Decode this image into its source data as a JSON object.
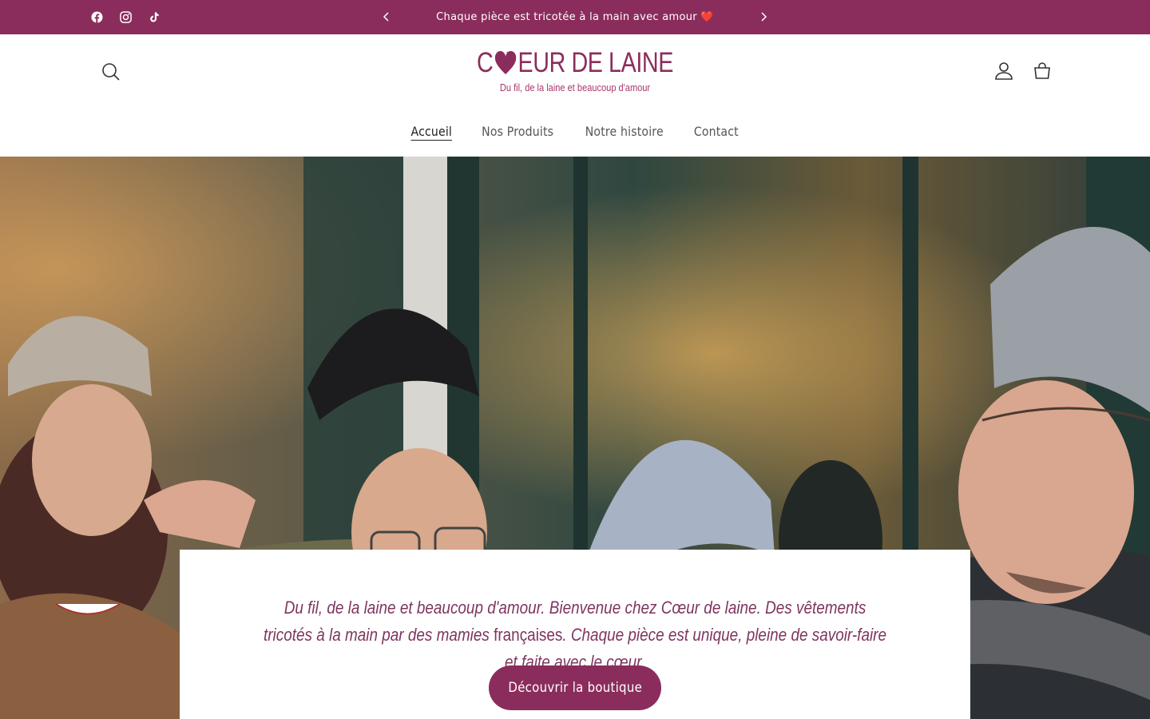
{
  "announcement": {
    "text": "Chaque pièce est tricotée à la main avec amour ❤️",
    "social": [
      {
        "name": "facebook-icon"
      },
      {
        "name": "instagram-icon"
      },
      {
        "name": "tiktok-icon"
      }
    ],
    "prev_icon": "chevron-left-icon",
    "next_icon": "chevron-right-icon"
  },
  "header": {
    "logo_title_left": "C",
    "logo_title_right": "EUR DE LAINE",
    "logo_subtitle": "Du fil, de la laine et beaucoup d'amour",
    "icons": {
      "search": "search-icon",
      "account": "user-icon",
      "cart": "cart-icon"
    }
  },
  "nav": {
    "items": [
      {
        "label": "Accueil",
        "active": true
      },
      {
        "label": "Nos Produits",
        "active": false
      },
      {
        "label": "Notre histoire",
        "active": false
      },
      {
        "label": "Contact",
        "active": false
      }
    ]
  },
  "hero": {
    "text_italic_1": "Du fil, de la laine et beaucoup d'amour. Bienvenue chez Cœur de laine. Des vêtements tricotés à la main par des mamies",
    "text_plain": " françaises",
    "text_italic_2": ". Chaque pièce est unique, pleine de savoir-faire et faite avec le cœur.",
    "cta_label": "Découvrir la boutique"
  },
  "colors": {
    "brand": "#8b2d5c",
    "text_accent": "#7e3560"
  }
}
